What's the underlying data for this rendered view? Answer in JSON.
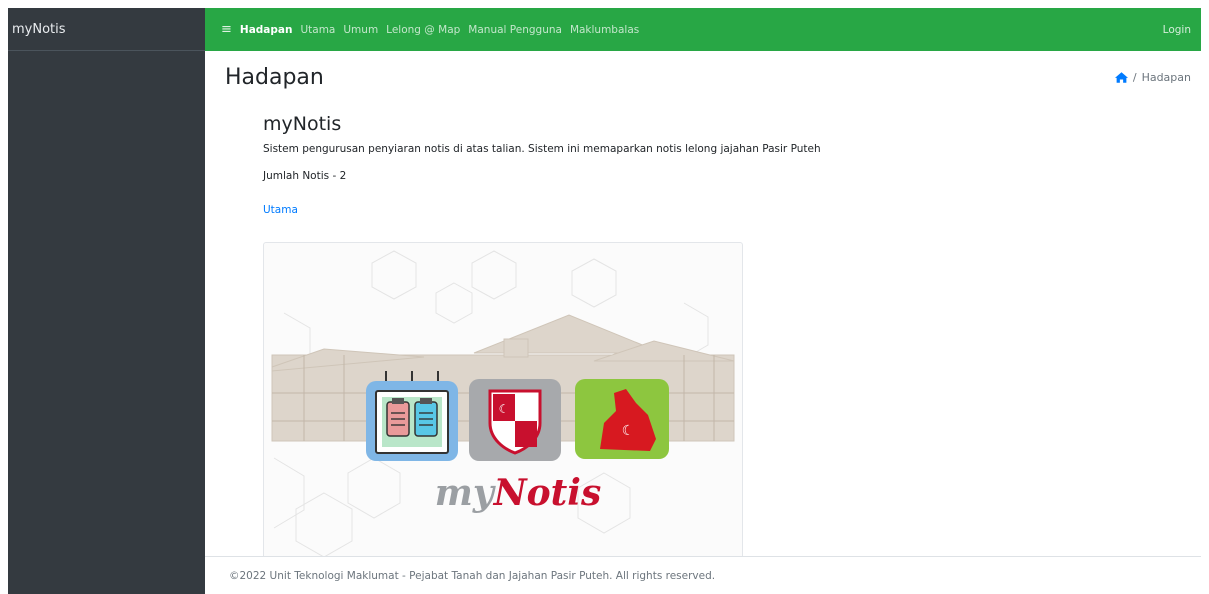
{
  "sidebar": {
    "brand": "myNotis"
  },
  "navbar": {
    "toggle_icon": "hamburger-menu-icon",
    "links": [
      "Hadapan",
      "Utama",
      "Umum",
      "Lelong @ Map",
      "Manual Pengguna",
      "Maklumbalas"
    ],
    "active_index": 0,
    "login": "Login",
    "bg_color": "#28a745"
  },
  "page": {
    "title": "Hadapan",
    "breadcrumb": {
      "home_icon": "home-icon",
      "current": "Hadapan"
    }
  },
  "main": {
    "heading": "myNotis",
    "description": "Sistem pengurusan penyiaran notis di atas talian. Sistem ini memaparkan notis lelong jajahan Pasir Puteh",
    "count_text": "Jumlah Notis - 2",
    "link": "Utama"
  },
  "logo": {
    "wordmark": "myNotis"
  },
  "footer": {
    "text": "©2022 Unit Teknologi Maklumat - Pejabat Tanah dan Jajahan Pasir Puteh. All rights reserved."
  }
}
